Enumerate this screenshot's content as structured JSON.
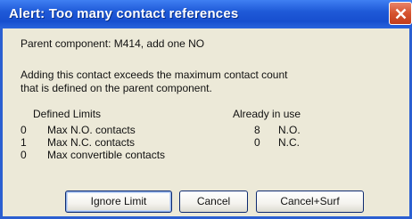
{
  "dialog": {
    "title": "Alert: Too many contact references",
    "message_line1": "Parent component: M414, add one NO",
    "message_line2": "Adding this contact exceeds the maximum contact count",
    "message_line3": "that is defined on the parent component.",
    "defined_limits_header": "Defined Limits",
    "already_in_use_header": "Already in use",
    "limits": [
      {
        "value": "0",
        "label": "Max N.O. contacts",
        "in_use_value": "8",
        "in_use_label": "N.O."
      },
      {
        "value": "1",
        "label": "Max N.C. contacts",
        "in_use_value": "0",
        "in_use_label": "N.C."
      },
      {
        "value": "0",
        "label": "Max convertible contacts"
      }
    ],
    "buttons": {
      "ignore_limit": "Ignore Limit",
      "cancel": "Cancel",
      "cancel_surf": "Cancel+Surf"
    }
  }
}
